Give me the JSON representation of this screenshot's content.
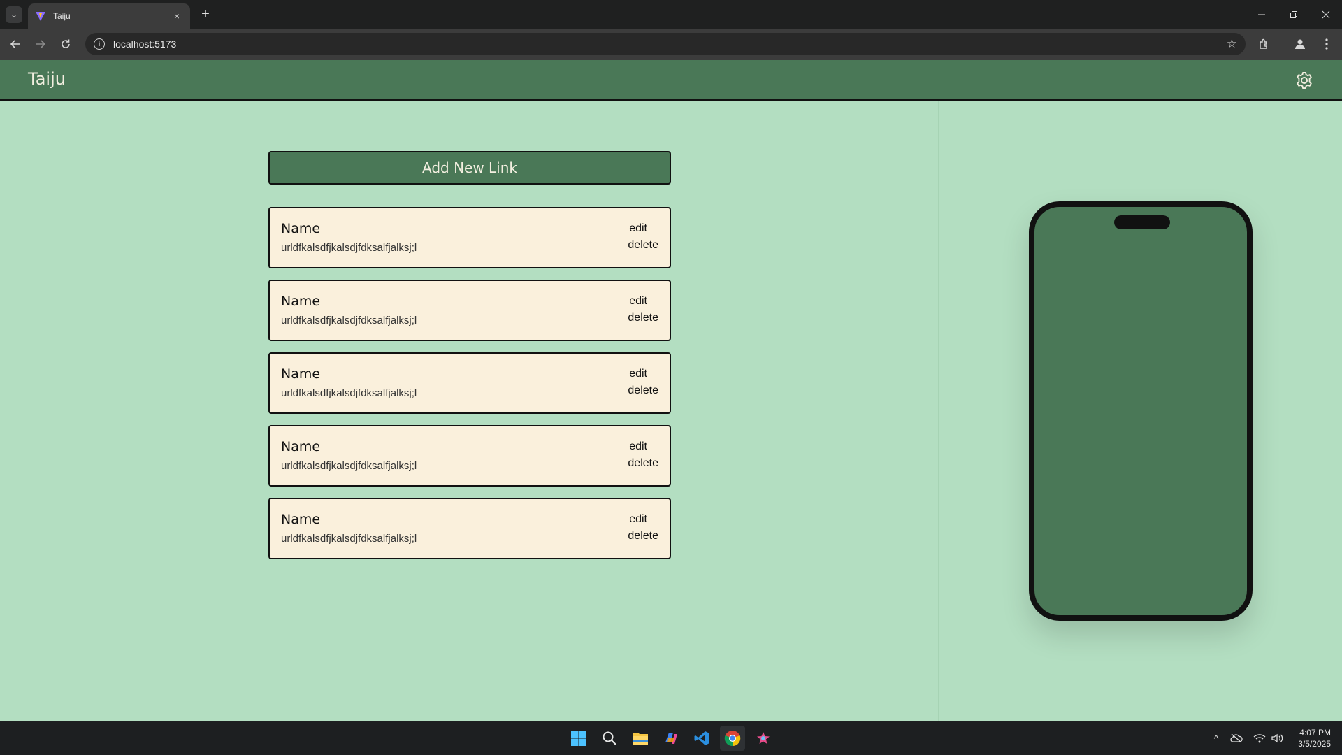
{
  "browser": {
    "tab_title": "Taiju",
    "url": "localhost:5173",
    "new_tab_symbol": "+",
    "tab_close_symbol": "×"
  },
  "app": {
    "title": "Taiju",
    "add_button_label": "Add New Link",
    "links": [
      {
        "name": "Name",
        "url": "urldfkalsdfjkalsdjfdksalfjalksj;l",
        "edit": "edit",
        "delete": "delete"
      },
      {
        "name": "Name",
        "url": "urldfkalsdfjkalsdjfdksalfjalksj;l",
        "edit": "edit",
        "delete": "delete"
      },
      {
        "name": "Name",
        "url": "urldfkalsdfjkalsdjfdksalfjalksj;l",
        "edit": "edit",
        "delete": "delete"
      },
      {
        "name": "Name",
        "url": "urldfkalsdfjkalsdjfdksalfjalksj;l",
        "edit": "edit",
        "delete": "delete"
      },
      {
        "name": "Name",
        "url": "urldfkalsdfjkalsdjfdksalfjalksj;l",
        "edit": "edit",
        "delete": "delete"
      }
    ]
  },
  "taskbar": {
    "time": "4:07 PM",
    "date": "3/5/2025",
    "apps": [
      "windows-start-icon",
      "search-icon",
      "file-explorer-icon",
      "copilot-icon",
      "vscode-icon",
      "chrome-icon",
      "paint-app-icon"
    ]
  },
  "colors": {
    "background": "#b3dec1",
    "header": "#4a7857",
    "card": "#faf0dc",
    "text_light": "#f3efe0"
  }
}
